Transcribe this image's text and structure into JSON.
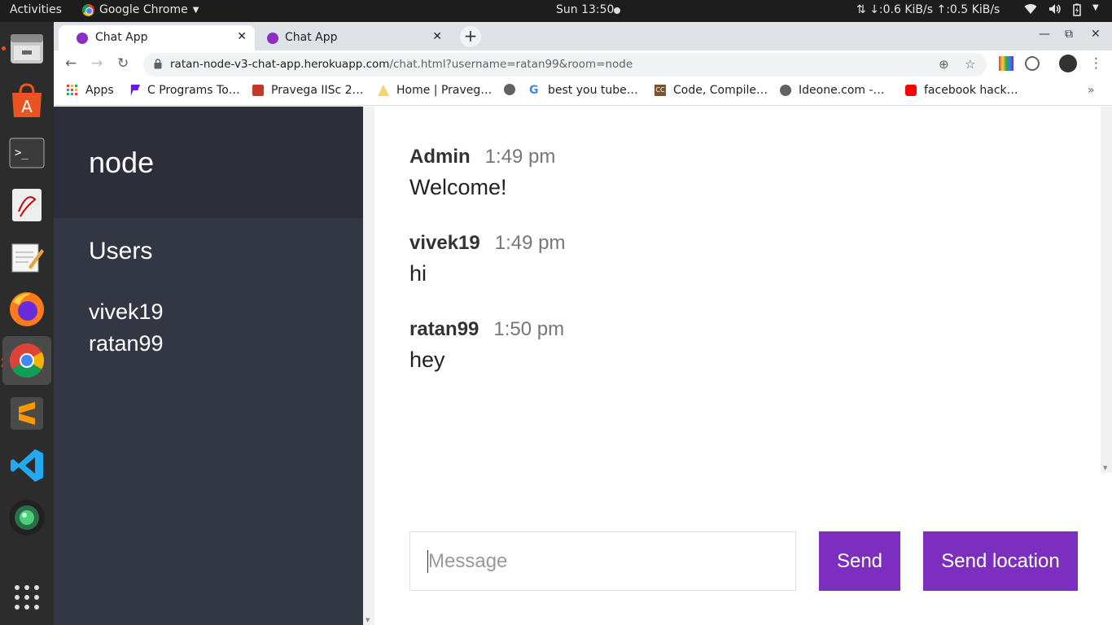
{
  "topbar": {
    "activities": "Activities",
    "app_name": "Google Chrome",
    "clock": "Sun 13:50",
    "network": "↓:0.6 KiB/s  ↑:0.5 KiB/s"
  },
  "dock": {
    "items": [
      "files-icon",
      "software-center-icon",
      "terminal-icon",
      "document-viewer-icon",
      "text-editor-icon",
      "firefox-icon",
      "chrome-icon",
      "sublime-text-icon",
      "vscode-icon",
      "camera-icon"
    ]
  },
  "browser": {
    "tabs": [
      {
        "label": "Chat App",
        "active": true
      },
      {
        "label": "Chat App",
        "active": false
      }
    ],
    "url_host": "ratan-node-v3-chat-app.herokuapp.com",
    "url_path": "/chat.html?username=ratan99&room=node",
    "bookmarks": [
      "Apps",
      "C Programs To…",
      "Pravega IISc 2…",
      "Home | Praveg…",
      "best you tube…",
      "Code, Compile…",
      "Ideone.com -…",
      "facebook hack…"
    ]
  },
  "chat": {
    "room": "node",
    "users_heading": "Users",
    "users": [
      "vivek19",
      "ratan99"
    ],
    "messages": [
      {
        "username": "Admin",
        "time": "1:49 pm",
        "text": "Welcome!"
      },
      {
        "username": "vivek19",
        "time": "1:49 pm",
        "text": "hi"
      },
      {
        "username": "ratan99",
        "time": "1:50 pm",
        "text": "hey"
      }
    ],
    "input_placeholder": "Message",
    "send_label": "Send",
    "location_label": "Send location",
    "accent_color": "#7c2fbf"
  }
}
